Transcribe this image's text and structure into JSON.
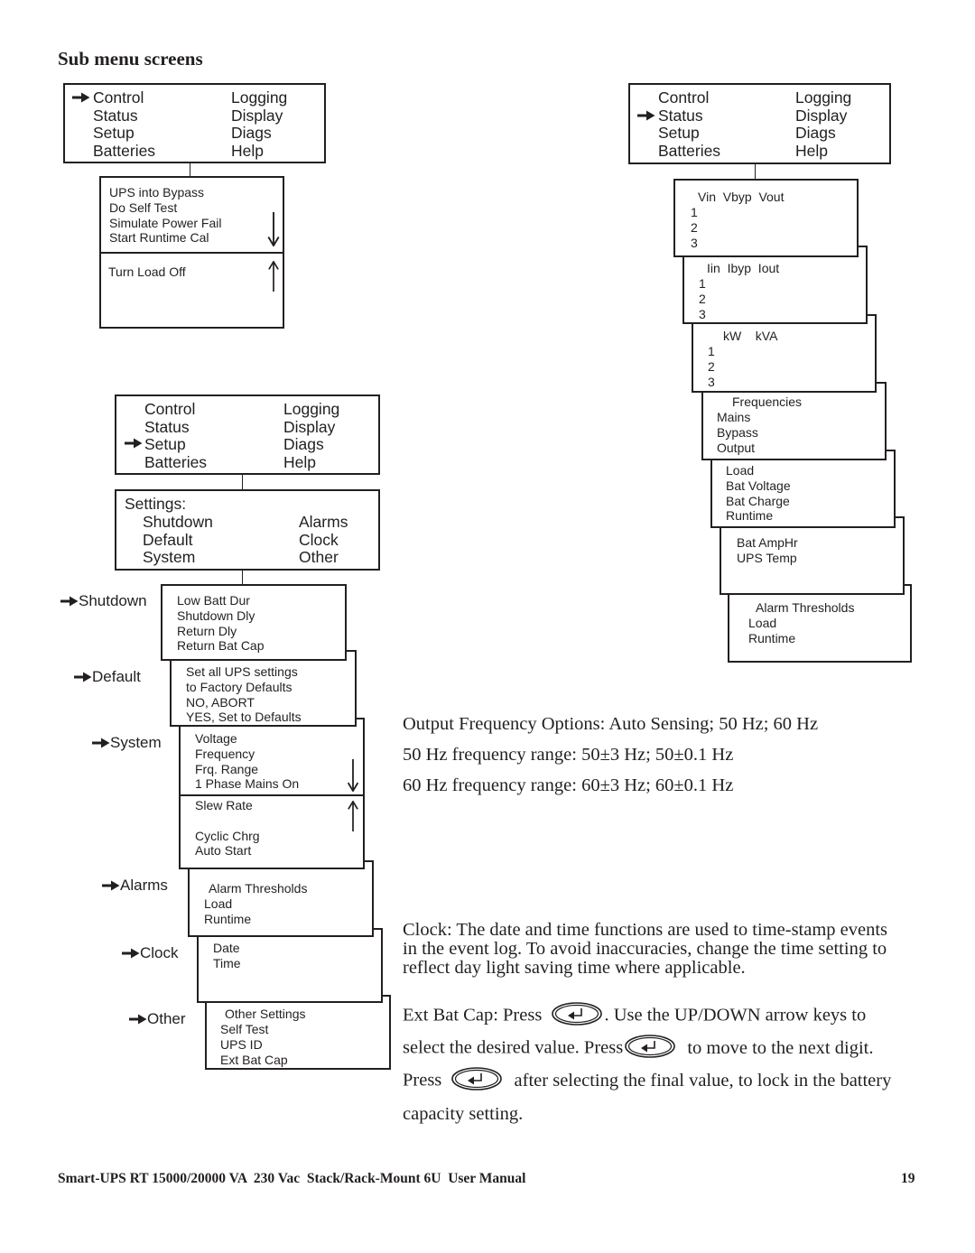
{
  "heading": "Sub menu screens",
  "main_menu": {
    "left": [
      "Control",
      "Status",
      "Setup",
      "Batteries"
    ],
    "right": [
      "Logging",
      "Display",
      "Diags",
      "Help"
    ]
  },
  "control_submenu": {
    "page1": [
      "UPS into Bypass",
      "Do Self Test",
      "Simulate Power Fail",
      "Start Runtime Cal"
    ],
    "page2": [
      "Turn Load Off"
    ]
  },
  "status_screens": {
    "voltage": {
      "header": "Vin  Vbyp  Vout",
      "rows": [
        "1",
        "2",
        "3"
      ]
    },
    "current": {
      "header": "Iin  Ibyp  Iout",
      "rows": [
        "1",
        "2",
        "3"
      ]
    },
    "power": {
      "header": "kW    kVA",
      "rows": [
        "1",
        "2",
        "3"
      ]
    },
    "frequencies": {
      "header": "Frequencies",
      "rows": [
        "Mains",
        "Bypass",
        "Output"
      ]
    },
    "battery": {
      "rows": [
        "Load",
        "Bat Voltage",
        "Bat Charge",
        "Runtime"
      ]
    },
    "misc": {
      "rows": [
        "Bat AmpHr",
        "UPS Temp"
      ]
    },
    "alarms": {
      "header": "Alarm Thresholds",
      "rows": [
        "Load",
        "Runtime"
      ]
    }
  },
  "settings_menu": {
    "title": "Settings:",
    "left": [
      "Shutdown",
      "Default",
      "System"
    ],
    "right": [
      "Alarms",
      "Clock",
      "Other"
    ]
  },
  "setup_submenus": {
    "shutdown": {
      "label": "Shutdown",
      "rows": [
        "Low Batt Dur",
        "Shutdown Dly",
        "Return Dly",
        "Return Bat Cap"
      ]
    },
    "default": {
      "label": "Default",
      "rows": [
        "Set all UPS settings",
        "to Factory Defaults",
        "NO, ABORT",
        "YES, Set to Defaults"
      ]
    },
    "system": {
      "label": "System",
      "page1": [
        "Voltage",
        "Frequency",
        "Frq. Range",
        "1 Phase Mains On"
      ],
      "page2": [
        "Slew Rate",
        "",
        "Cyclic Chrg",
        "Auto Start"
      ]
    },
    "alarms": {
      "label": "Alarms",
      "header": "Alarm Thresholds",
      "rows": [
        "Load",
        "Runtime"
      ]
    },
    "clock": {
      "label": "Clock",
      "rows": [
        "Date",
        "Time"
      ]
    },
    "other": {
      "label": "Other",
      "header": "Other Settings",
      "rows": [
        "Self Test",
        "UPS ID",
        "Ext Bat Cap"
      ]
    }
  },
  "frequency_notes": [
    "Output Frequency Options: Auto Sensing; 50 Hz; 60 Hz",
    "50 Hz frequency range: 50±3 Hz; 50±0.1 Hz",
    "60 Hz frequency range: 60±3 Hz; 60±0.1 Hz"
  ],
  "clock_note": [
    "Clock: The date and time functions are used to time-stamp events",
    "in the event log. To avoid inaccuracies, change the time setting to",
    "reflect day light saving time where applicable."
  ],
  "ext_bat_note": {
    "line1_a": "Ext Bat Cap: Press",
    "line1_b": ". Use the UP/DOWN arrow keys to",
    "line2_a": "select the desired value. Press",
    "line2_b": "to move to the next digit.",
    "line3_a": "Press",
    "line3_b": "after selecting the final value, to lock in the battery",
    "line4": "capacity setting."
  },
  "footer": {
    "title": "Smart-UPS RT 15000/20000 VA  230 Vac  Stack/Rack-Mount 6U  User Manual",
    "page": "19"
  },
  "icons": {
    "pointer": "right-arrow-icon",
    "scroll_down": "down-arrow-icon",
    "scroll_up": "up-arrow-icon",
    "enter_key": "enter-key-icon"
  }
}
